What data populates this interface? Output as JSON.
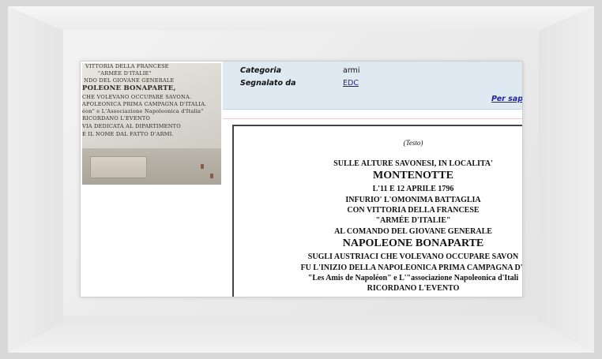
{
  "plaque": {
    "lines": [
      "VITTORIA DELLA FRANCESE",
      "\"ARMÉE D'ITALIE\"",
      "NDO DEL GIOVANE GENERALE",
      "POLEONE BONAPARTE,",
      "CHE VOLEVANO OCCUPARE SAVONA.",
      "APOLEONICA PRIMA CAMPAGNA D'ITALIA.",
      "éon\" e L'Associazione Napoleonica d'Italia\"",
      "RICORDANO L'EVENTO",
      "VIA DEDICATA AL DIPARTIMENTO",
      "E IL NOME DAL FATTO D'ARMI."
    ]
  },
  "info": {
    "categoria_label": "Categoria",
    "categoria_value": "armi",
    "segnalato_label": "Segnalato da",
    "segnalato_value": "EDC",
    "more_link": "Per sap"
  },
  "text": {
    "title": "(Testo)",
    "lines": [
      "SULLE ALTURE SAVONESI, IN LOCALITA'",
      "MONTENOTTE",
      "L'11 E 12 APRILE 1796",
      "INFURIO' L'OMONIMA BATTAGLIA",
      "CON VITTORIA DELLA FRANCESE",
      "\"ARMÉE D'ITALIE\"",
      "AL COMANDO DEL GIOVANE GENERALE",
      "NAPOLEONE BONAPARTE",
      "SUGLI AUSTRIACI CHE VOLEVANO OCCUPARE SAVON",
      "FU L'INIZIO DELLA NAPOLEONICA PRIMA CAMPAGNA D'I",
      "\"Les Amis de Napoléon\" e L'\"associazione Napoleonica d'Itali",
      "RICORDANO L'EVENTO"
    ]
  },
  "colors": {
    "info_background": "#dfe9f2",
    "link": "#2222aa",
    "frame": "#d7d7d7"
  }
}
